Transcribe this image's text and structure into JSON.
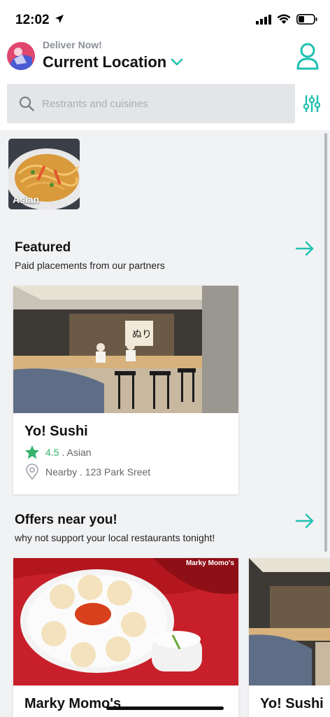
{
  "status_bar": {
    "time": "12:02"
  },
  "header": {
    "deliver_label": "Deliver Now!",
    "location": "Current Location",
    "search_placeholder": "Restrants and cuisines"
  },
  "categories": [
    {
      "label": "Asian"
    }
  ],
  "featured": {
    "title": "Featured",
    "subtitle": "Paid placements from our partners",
    "cards": [
      {
        "name": "Yo! Sushi",
        "rating": "4.5",
        "cuisine": ". Asian",
        "location": "Nearby . 123 Park Sreet"
      }
    ]
  },
  "offers": {
    "title": "Offers near you!",
    "subtitle": "why not support your local restaurants tonight!",
    "cards": [
      {
        "name": "Marky Momo's",
        "logo_text": "Marky Momo's"
      },
      {
        "name": "Yo! Sushi"
      }
    ]
  },
  "colors": {
    "accent": "#1fc0b0",
    "rating": "#34b36b"
  }
}
